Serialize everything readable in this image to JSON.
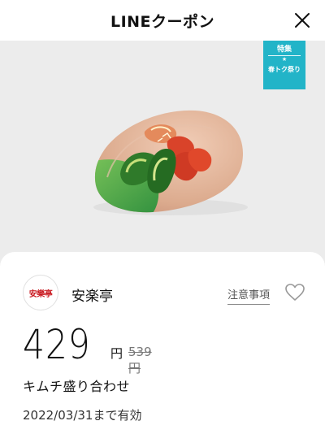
{
  "header": {
    "title": "LINEクーポン",
    "close_icon": "close-icon"
  },
  "hero": {
    "badge": {
      "top": "特集",
      "star": "★",
      "bottom": "春トク祭り",
      "color": "#22b4c8"
    }
  },
  "coupon": {
    "logo_text": "安樂亭",
    "store_name": "安楽亭",
    "notice_label": "注意事項",
    "favorite_icon": "heart-icon",
    "price": "429",
    "price_unit": "円",
    "original_price": "539円",
    "item_name": "キムチ盛り合わせ",
    "expiry": "2022/03/31まで有効"
  },
  "colors": {
    "brand_red": "#c8161d",
    "badge_blue": "#22b4c8"
  }
}
